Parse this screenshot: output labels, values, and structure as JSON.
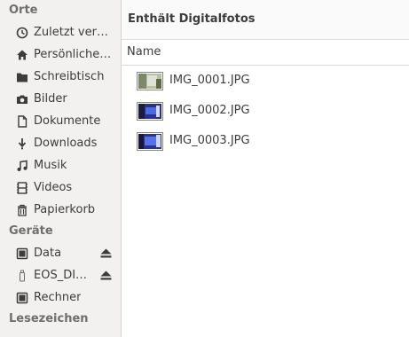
{
  "sidebar": {
    "places_heading": "Orte",
    "places": [
      {
        "label": "Zuletzt ver…",
        "icon": "clock-icon"
      },
      {
        "label": "Persönliche…",
        "icon": "home-icon"
      },
      {
        "label": "Schreibtisch",
        "icon": "folder-icon"
      },
      {
        "label": "Bilder",
        "icon": "camera-icon"
      },
      {
        "label": "Dokumente",
        "icon": "document-icon"
      },
      {
        "label": "Downloads",
        "icon": "download-icon"
      },
      {
        "label": "Musik",
        "icon": "music-icon"
      },
      {
        "label": "Videos",
        "icon": "film-icon"
      },
      {
        "label": "Papierkorb",
        "icon": "trash-icon"
      }
    ],
    "devices_heading": "Geräte",
    "devices": [
      {
        "label": "Data",
        "icon": "drive-icon",
        "eject": true
      },
      {
        "label": "EOS_DI…",
        "icon": "usb-stick-icon",
        "eject": true
      },
      {
        "label": "Rechner",
        "icon": "drive-icon",
        "eject": false
      }
    ],
    "bookmarks_heading": "Lesezeichen"
  },
  "main": {
    "path_title": "Enthält Digitalfotos",
    "column_name": "Name",
    "files": [
      {
        "name": "IMG_0001.JPG"
      },
      {
        "name": "IMG_0002.JPG"
      },
      {
        "name": "IMG_0003.JPG"
      }
    ]
  }
}
